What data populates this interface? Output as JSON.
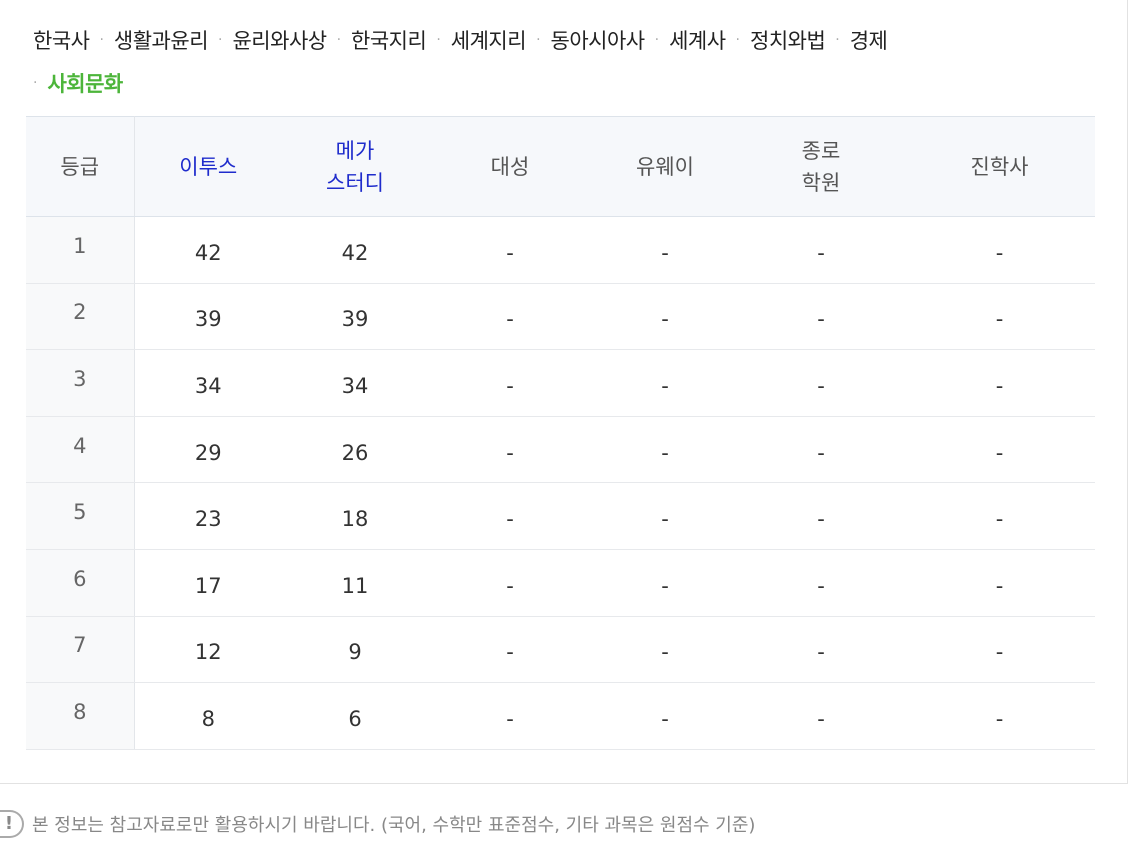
{
  "subject_tabs": [
    {
      "label": "한국사",
      "active": false
    },
    {
      "label": "생활과윤리",
      "active": false
    },
    {
      "label": "윤리와사상",
      "active": false
    },
    {
      "label": "한국지리",
      "active": false
    },
    {
      "label": "세계지리",
      "active": false
    },
    {
      "label": "동아시아사",
      "active": false
    },
    {
      "label": "세계사",
      "active": false
    },
    {
      "label": "정치와법",
      "active": false
    },
    {
      "label": "경제",
      "active": false
    },
    {
      "label": "사회문화",
      "active": true
    }
  ],
  "table": {
    "headers": {
      "grade": "등급",
      "etoos": "이투스",
      "megastudy_line1": "메가",
      "megastudy_line2": "스터디",
      "daesung": "대성",
      "uway": "유웨이",
      "jongro_line1": "종로",
      "jongro_line2": "학원",
      "jinhak": "진학사"
    },
    "rows": [
      {
        "grade": "1",
        "etoos": "42",
        "megastudy": "42",
        "daesung": "-",
        "uway": "-",
        "jongro": "-",
        "jinhak": "-"
      },
      {
        "grade": "2",
        "etoos": "39",
        "megastudy": "39",
        "daesung": "-",
        "uway": "-",
        "jongro": "-",
        "jinhak": "-"
      },
      {
        "grade": "3",
        "etoos": "34",
        "megastudy": "34",
        "daesung": "-",
        "uway": "-",
        "jongro": "-",
        "jinhak": "-"
      },
      {
        "grade": "4",
        "etoos": "29",
        "megastudy": "26",
        "daesung": "-",
        "uway": "-",
        "jongro": "-",
        "jinhak": "-"
      },
      {
        "grade": "5",
        "etoos": "23",
        "megastudy": "18",
        "daesung": "-",
        "uway": "-",
        "jongro": "-",
        "jinhak": "-"
      },
      {
        "grade": "6",
        "etoos": "17",
        "megastudy": "11",
        "daesung": "-",
        "uway": "-",
        "jongro": "-",
        "jinhak": "-"
      },
      {
        "grade": "7",
        "etoos": "12",
        "megastudy": "9",
        "daesung": "-",
        "uway": "-",
        "jongro": "-",
        "jinhak": "-"
      },
      {
        "grade": "8",
        "etoos": "8",
        "megastudy": "6",
        "daesung": "-",
        "uway": "-",
        "jongro": "-",
        "jinhak": "-"
      }
    ]
  },
  "footnote": {
    "icon": "exclamation-circle-icon",
    "text": "본 정보는 참고자료로만 활용하시기 바랍니다. (국어, 수학만 표준점수, 기타 과목은 원점수 기준)"
  },
  "colors": {
    "active_tab": "#4cb53a",
    "header_link": "#1f2ccc",
    "header_bg": "#f6f8fb"
  }
}
